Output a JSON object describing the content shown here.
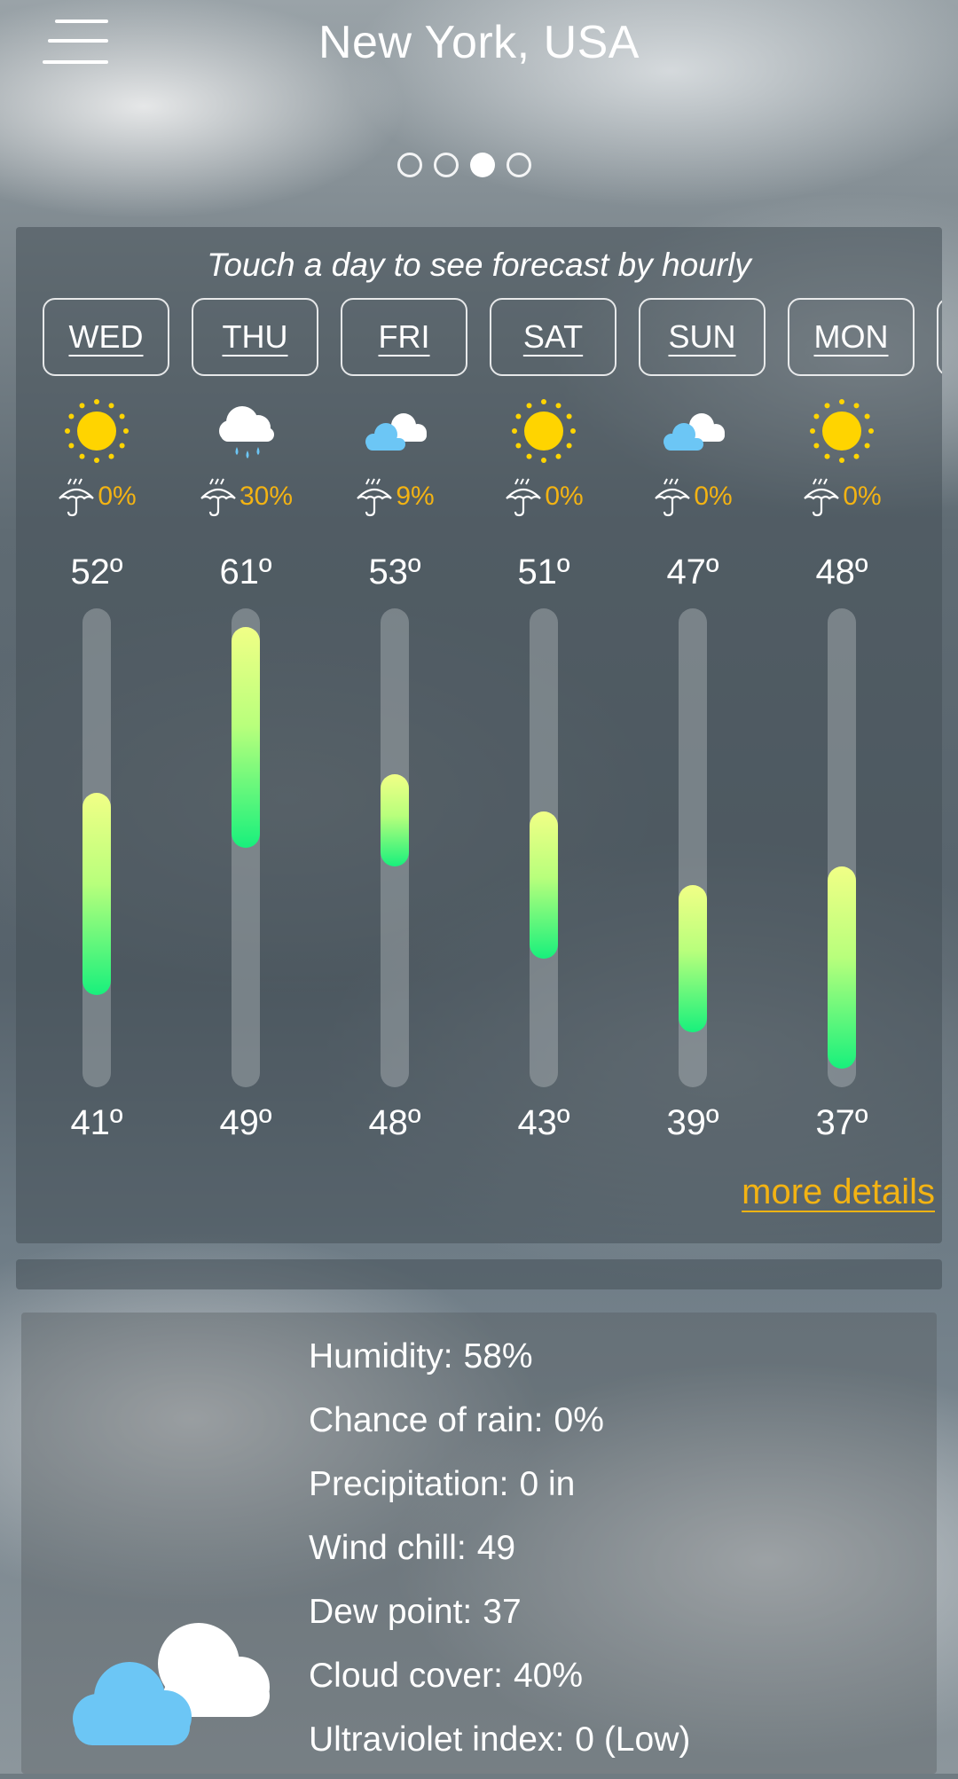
{
  "header": {
    "title": "New York, USA",
    "page_dots": {
      "count": 4,
      "active_index": 2
    }
  },
  "forecast": {
    "hint": "Touch a day to see forecast by hourly",
    "more_details": "more details",
    "days": [
      {
        "day": "WED",
        "icon": "sun-icon",
        "rain": "0%",
        "high": "52º",
        "low": "41º",
        "high_value": 52,
        "low_value": 41
      },
      {
        "day": "THU",
        "icon": "rain-cloud-icon",
        "rain": "30%",
        "high": "61º",
        "low": "49º",
        "high_value": 61,
        "low_value": 49
      },
      {
        "day": "FRI",
        "icon": "partly-cloudy-icon",
        "rain": "9%",
        "high": "53º",
        "low": "48º",
        "high_value": 53,
        "low_value": 48
      },
      {
        "day": "SAT",
        "icon": "sun-icon",
        "rain": "0%",
        "high": "51º",
        "low": "43º",
        "high_value": 51,
        "low_value": 43
      },
      {
        "day": "SUN",
        "icon": "partly-cloudy-icon",
        "rain": "0%",
        "high": "47º",
        "low": "39º",
        "high_value": 47,
        "low_value": 39
      },
      {
        "day": "MON",
        "icon": "sun-icon",
        "rain": "0%",
        "high": "48º",
        "low": "37º",
        "high_value": 48,
        "low_value": 37
      }
    ],
    "scale": {
      "min": 36,
      "max": 62
    }
  },
  "details": {
    "icon": "cloudy-icon",
    "items": [
      {
        "label": "Humidity:",
        "value": "58%"
      },
      {
        "label": "Chance of rain:",
        "value": "0%"
      },
      {
        "label": "Precipitation:",
        "value": "0 in"
      },
      {
        "label": "Wind chill:",
        "value": "49"
      },
      {
        "label": "Dew point:",
        "value": "37"
      },
      {
        "label": "Cloud cover:",
        "value": "40%"
      },
      {
        "label": "Ultraviolet index:",
        "value": "0 (Low)"
      }
    ]
  },
  "colors": {
    "accent": "#f3b313",
    "bar_top": "#f1ff86",
    "bar_bottom": "#18f07c",
    "sun": "#ffd400",
    "cloud_blue": "#6cc6f5"
  }
}
